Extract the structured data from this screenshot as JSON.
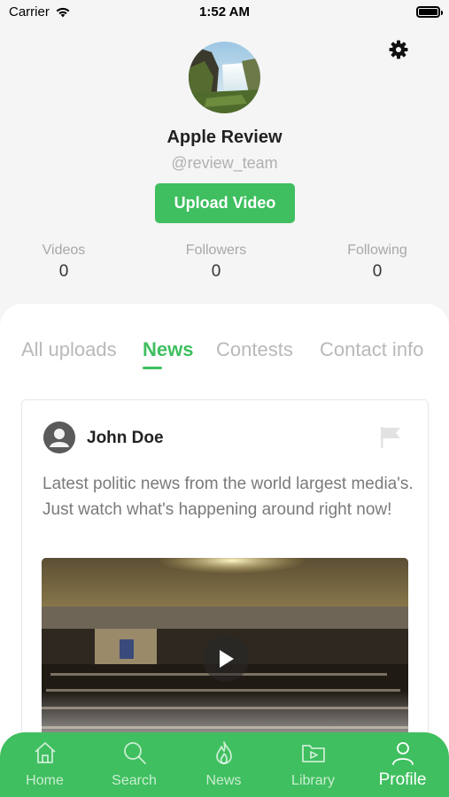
{
  "status_bar": {
    "carrier": "Carrier",
    "time": "1:52 AM"
  },
  "profile": {
    "name": "Apple Review",
    "handle": "@review_team",
    "upload_label": "Upload Video"
  },
  "stats": [
    {
      "label": "Videos",
      "value": "0"
    },
    {
      "label": "Followers",
      "value": "0"
    },
    {
      "label": "Following",
      "value": "0"
    }
  ],
  "tabs": [
    {
      "label": "All uploads",
      "active": false
    },
    {
      "label": "News",
      "active": true
    },
    {
      "label": "Contests",
      "active": false
    },
    {
      "label": "Contact info",
      "active": false
    }
  ],
  "post": {
    "author": "John Doe",
    "text": "Latest politic news from the world largest media's. Just watch what's happening around right now!"
  },
  "tabbar": [
    {
      "label": "Home",
      "icon": "home-icon"
    },
    {
      "label": "Search",
      "icon": "search-icon"
    },
    {
      "label": "News",
      "icon": "flame-icon"
    },
    {
      "label": "Library",
      "icon": "video-folder-icon"
    },
    {
      "label": "Profile",
      "icon": "person-icon",
      "active": true
    }
  ],
  "colors": {
    "accent": "#3fbf5f",
    "muted_text": "#b0b0b0",
    "background": "#f5f5f5"
  }
}
